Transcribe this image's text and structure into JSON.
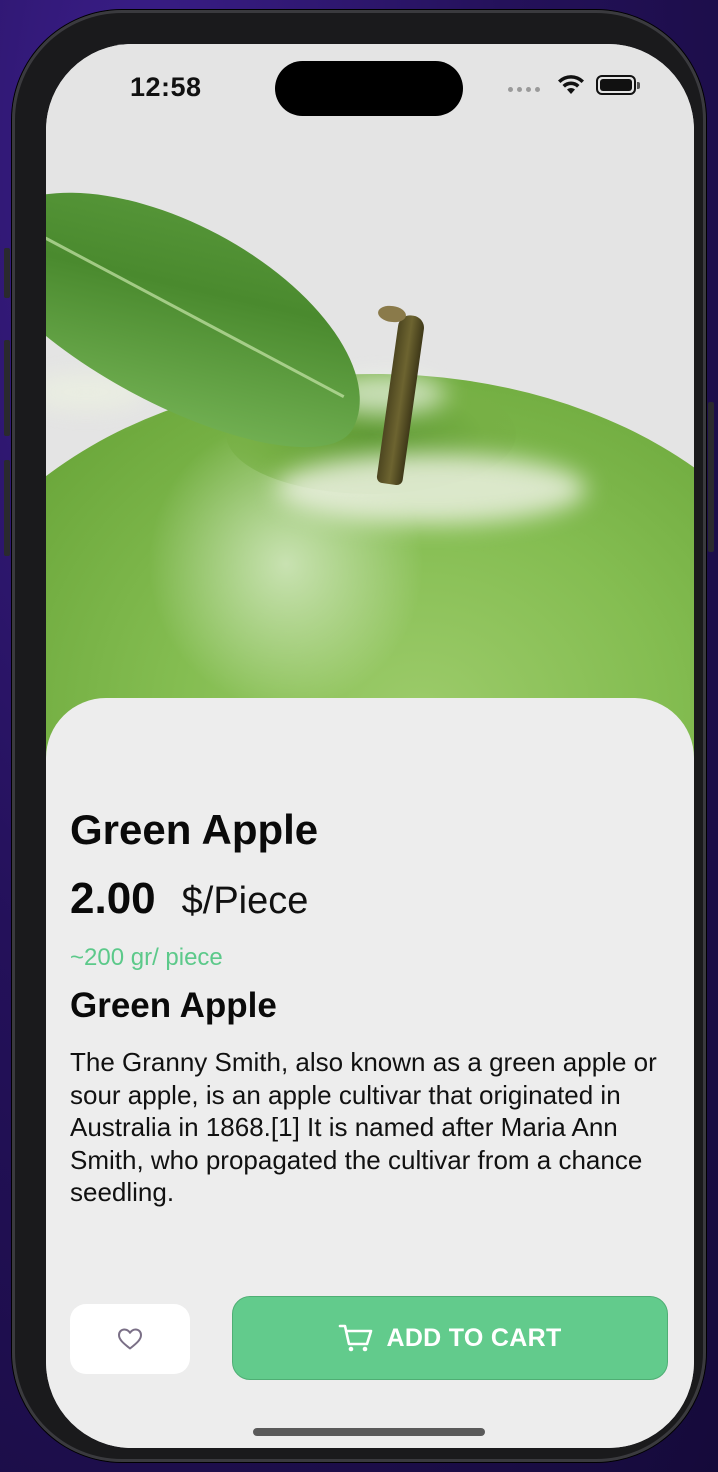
{
  "status_bar": {
    "time": "12:58"
  },
  "product": {
    "name": "Green Apple",
    "price": "2.00",
    "unit": "$/Piece",
    "weight_note": "~200 gr/ piece",
    "description_title": "Green Apple",
    "description": "The Granny Smith, also known as a green apple or sour apple, is an apple cultivar that originated in Australia in 1868.[1] It is named after Maria Ann Smith, who propagated the cultivar from a chance seedling."
  },
  "actions": {
    "favorite_icon": "heart-outline-icon",
    "cart_icon": "cart-icon",
    "add_to_cart_label": "ADD TO CART"
  },
  "colors": {
    "accent_green": "#62cb8c",
    "weight_text": "#5cc98a",
    "card_background": "#ededed"
  }
}
